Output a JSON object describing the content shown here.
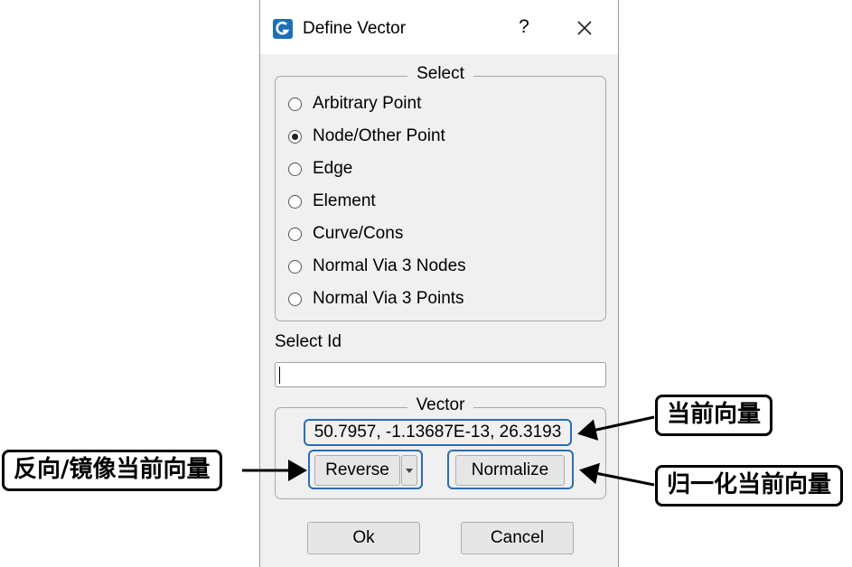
{
  "window": {
    "title": "Define Vector",
    "help_label": "?",
    "icon": "app-logo-icon",
    "close_icon": "close-icon"
  },
  "select_group": {
    "legend": "Select",
    "options": [
      {
        "label": "Arbitrary Point",
        "checked": false
      },
      {
        "label": "Node/Other Point",
        "checked": true
      },
      {
        "label": "Edge",
        "checked": false
      },
      {
        "label": "Element",
        "checked": false
      },
      {
        "label": "Curve/Cons",
        "checked": false
      },
      {
        "label": "Normal Via 3 Nodes",
        "checked": false
      },
      {
        "label": "Normal Via 3 Points",
        "checked": false
      }
    ]
  },
  "select_id": {
    "label": "Select Id",
    "value": ""
  },
  "vector_group": {
    "legend": "Vector",
    "value": "50.7957, -1.13687E-13, 26.3193",
    "reverse_label": "Reverse",
    "normalize_label": "Normalize"
  },
  "buttons": {
    "ok_label": "Ok",
    "cancel_label": "Cancel"
  },
  "annotations": {
    "current_vector": "当前向量",
    "reverse": "反向/镜像当前向量",
    "normalize": "归一化当前向量"
  },
  "colors": {
    "highlight": "#2a6db5",
    "dialog_bg": "#f0f0f0",
    "app_icon": "#1f6fb5"
  }
}
